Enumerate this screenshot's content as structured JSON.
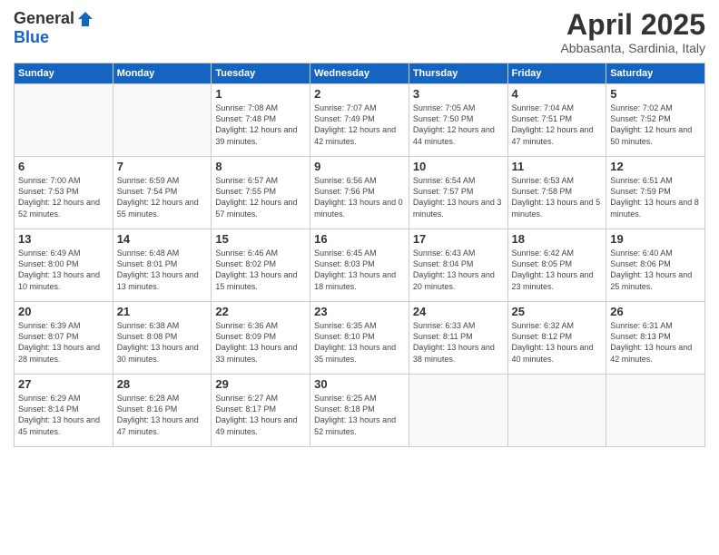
{
  "logo": {
    "general": "General",
    "blue": "Blue"
  },
  "header": {
    "month": "April 2025",
    "location": "Abbasanta, Sardinia, Italy"
  },
  "weekdays": [
    "Sunday",
    "Monday",
    "Tuesday",
    "Wednesday",
    "Thursday",
    "Friday",
    "Saturday"
  ],
  "weeks": [
    [
      {
        "day": "",
        "info": ""
      },
      {
        "day": "",
        "info": ""
      },
      {
        "day": "1",
        "info": "Sunrise: 7:08 AM\nSunset: 7:48 PM\nDaylight: 12 hours and 39 minutes."
      },
      {
        "day": "2",
        "info": "Sunrise: 7:07 AM\nSunset: 7:49 PM\nDaylight: 12 hours and 42 minutes."
      },
      {
        "day": "3",
        "info": "Sunrise: 7:05 AM\nSunset: 7:50 PM\nDaylight: 12 hours and 44 minutes."
      },
      {
        "day": "4",
        "info": "Sunrise: 7:04 AM\nSunset: 7:51 PM\nDaylight: 12 hours and 47 minutes."
      },
      {
        "day": "5",
        "info": "Sunrise: 7:02 AM\nSunset: 7:52 PM\nDaylight: 12 hours and 50 minutes."
      }
    ],
    [
      {
        "day": "6",
        "info": "Sunrise: 7:00 AM\nSunset: 7:53 PM\nDaylight: 12 hours and 52 minutes."
      },
      {
        "day": "7",
        "info": "Sunrise: 6:59 AM\nSunset: 7:54 PM\nDaylight: 12 hours and 55 minutes."
      },
      {
        "day": "8",
        "info": "Sunrise: 6:57 AM\nSunset: 7:55 PM\nDaylight: 12 hours and 57 minutes."
      },
      {
        "day": "9",
        "info": "Sunrise: 6:56 AM\nSunset: 7:56 PM\nDaylight: 13 hours and 0 minutes."
      },
      {
        "day": "10",
        "info": "Sunrise: 6:54 AM\nSunset: 7:57 PM\nDaylight: 13 hours and 3 minutes."
      },
      {
        "day": "11",
        "info": "Sunrise: 6:53 AM\nSunset: 7:58 PM\nDaylight: 13 hours and 5 minutes."
      },
      {
        "day": "12",
        "info": "Sunrise: 6:51 AM\nSunset: 7:59 PM\nDaylight: 13 hours and 8 minutes."
      }
    ],
    [
      {
        "day": "13",
        "info": "Sunrise: 6:49 AM\nSunset: 8:00 PM\nDaylight: 13 hours and 10 minutes."
      },
      {
        "day": "14",
        "info": "Sunrise: 6:48 AM\nSunset: 8:01 PM\nDaylight: 13 hours and 13 minutes."
      },
      {
        "day": "15",
        "info": "Sunrise: 6:46 AM\nSunset: 8:02 PM\nDaylight: 13 hours and 15 minutes."
      },
      {
        "day": "16",
        "info": "Sunrise: 6:45 AM\nSunset: 8:03 PM\nDaylight: 13 hours and 18 minutes."
      },
      {
        "day": "17",
        "info": "Sunrise: 6:43 AM\nSunset: 8:04 PM\nDaylight: 13 hours and 20 minutes."
      },
      {
        "day": "18",
        "info": "Sunrise: 6:42 AM\nSunset: 8:05 PM\nDaylight: 13 hours and 23 minutes."
      },
      {
        "day": "19",
        "info": "Sunrise: 6:40 AM\nSunset: 8:06 PM\nDaylight: 13 hours and 25 minutes."
      }
    ],
    [
      {
        "day": "20",
        "info": "Sunrise: 6:39 AM\nSunset: 8:07 PM\nDaylight: 13 hours and 28 minutes."
      },
      {
        "day": "21",
        "info": "Sunrise: 6:38 AM\nSunset: 8:08 PM\nDaylight: 13 hours and 30 minutes."
      },
      {
        "day": "22",
        "info": "Sunrise: 6:36 AM\nSunset: 8:09 PM\nDaylight: 13 hours and 33 minutes."
      },
      {
        "day": "23",
        "info": "Sunrise: 6:35 AM\nSunset: 8:10 PM\nDaylight: 13 hours and 35 minutes."
      },
      {
        "day": "24",
        "info": "Sunrise: 6:33 AM\nSunset: 8:11 PM\nDaylight: 13 hours and 38 minutes."
      },
      {
        "day": "25",
        "info": "Sunrise: 6:32 AM\nSunset: 8:12 PM\nDaylight: 13 hours and 40 minutes."
      },
      {
        "day": "26",
        "info": "Sunrise: 6:31 AM\nSunset: 8:13 PM\nDaylight: 13 hours and 42 minutes."
      }
    ],
    [
      {
        "day": "27",
        "info": "Sunrise: 6:29 AM\nSunset: 8:14 PM\nDaylight: 13 hours and 45 minutes."
      },
      {
        "day": "28",
        "info": "Sunrise: 6:28 AM\nSunset: 8:16 PM\nDaylight: 13 hours and 47 minutes."
      },
      {
        "day": "29",
        "info": "Sunrise: 6:27 AM\nSunset: 8:17 PM\nDaylight: 13 hours and 49 minutes."
      },
      {
        "day": "30",
        "info": "Sunrise: 6:25 AM\nSunset: 8:18 PM\nDaylight: 13 hours and 52 minutes."
      },
      {
        "day": "",
        "info": ""
      },
      {
        "day": "",
        "info": ""
      },
      {
        "day": "",
        "info": ""
      }
    ]
  ]
}
